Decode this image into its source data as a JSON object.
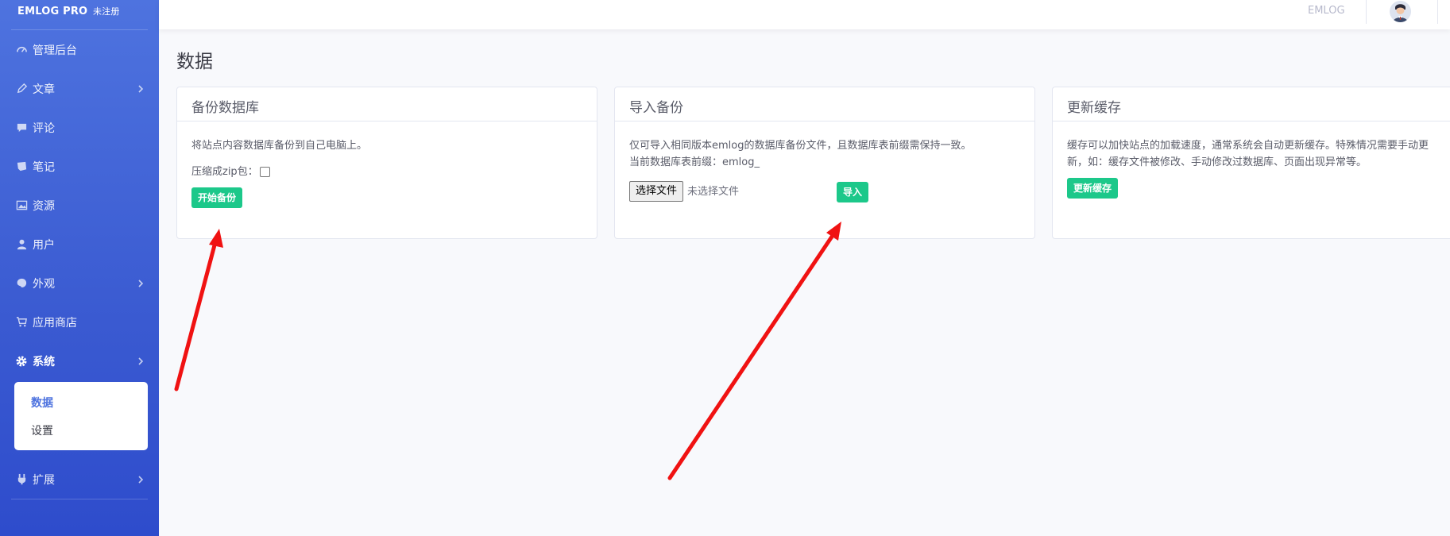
{
  "brand": {
    "name": "EMLOG PRO",
    "sub": "未注册"
  },
  "sidebar": {
    "items": [
      {
        "label": "管理后台",
        "icon": "gauge-icon"
      },
      {
        "label": "文章",
        "icon": "pencil-icon",
        "has_children": true
      },
      {
        "label": "评论",
        "icon": "comment-icon"
      },
      {
        "label": "笔记",
        "icon": "note-icon"
      },
      {
        "label": "资源",
        "icon": "image-icon"
      },
      {
        "label": "用户",
        "icon": "user-icon"
      },
      {
        "label": "外观",
        "icon": "palette-icon",
        "has_children": true
      },
      {
        "label": "应用商店",
        "icon": "cart-icon"
      },
      {
        "label": "系统",
        "icon": "gear-icon",
        "has_children": true,
        "active": true
      },
      {
        "label": "扩展",
        "icon": "plug-icon",
        "has_children": true
      }
    ],
    "submenu": [
      {
        "label": "数据",
        "current": true
      },
      {
        "label": "设置"
      }
    ]
  },
  "topbar": {
    "site_label": "EMLOG"
  },
  "page": {
    "title": "数据"
  },
  "cards": {
    "backup": {
      "title": "备份数据库",
      "desc": "将站点内容数据库备份到自己电脑上。",
      "zip_label": "压缩成zip包：",
      "button": "开始备份"
    },
    "import": {
      "title": "导入备份",
      "desc": "仅可导入相同版本emlog的数据库备份文件，且数据库表前缀需保持一致。",
      "prefix_line": "当前数据库表前缀：emlog_",
      "file_button": "选择文件",
      "file_none": "未选择文件",
      "button": "导入"
    },
    "cache": {
      "title": "更新缓存",
      "desc_line1": "缓存可以加快站点的加载速度，通常系统会自动更新缓存。特殊情况需要手动更",
      "desc_line2": "新，如：缓存文件被修改、手动修改过数据库、页面出现异常等。",
      "button": "更新缓存"
    }
  },
  "colors": {
    "sidebar_top": "#4e73df",
    "sidebar_bottom": "#2e4ccc",
    "button_green": "#1cc88a",
    "arrow_red": "#f01212"
  }
}
